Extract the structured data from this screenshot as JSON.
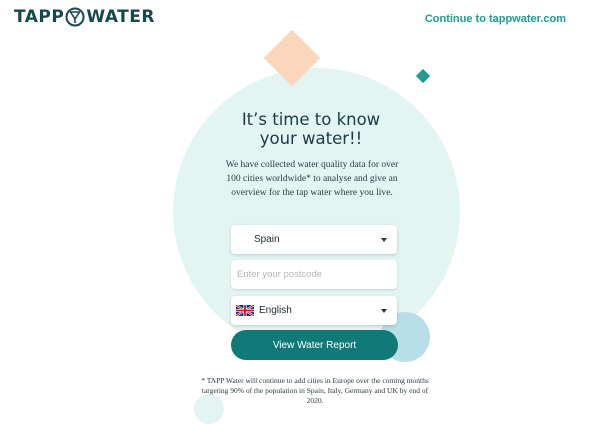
{
  "header": {
    "logo_left": "TAPP",
    "logo_right": "WATER",
    "continue_link": "Continue to tappwater.com"
  },
  "hero": {
    "heading_line1": "It’s time to know",
    "heading_line2": "your water!!",
    "intro": "We have collected water quality data for over 100 cities worldwide* to analyse and give an overview for the tap water where you live."
  },
  "form": {
    "country": {
      "value": "Spain",
      "icon": "chevron-down-icon"
    },
    "postcode": {
      "value": "",
      "placeholder": "Enter your postcode"
    },
    "language": {
      "value": "English",
      "flag_icon": "uk-flag-icon",
      "icon": "chevron-down-icon"
    },
    "submit_label": "View Water Report"
  },
  "footnote": "* TAPP Water will continue to add cities in Europe over the coming months targeting 90% of the population in Spain, Italy, Germany and UK by end of 2020.",
  "colors": {
    "accent": "#1f9c8f",
    "button": "#0f7a78",
    "circle": "#e3f5f3",
    "peach": "#fad6bd",
    "small_circle": "#b8dfe9",
    "heading_text": "#1b3a47"
  }
}
